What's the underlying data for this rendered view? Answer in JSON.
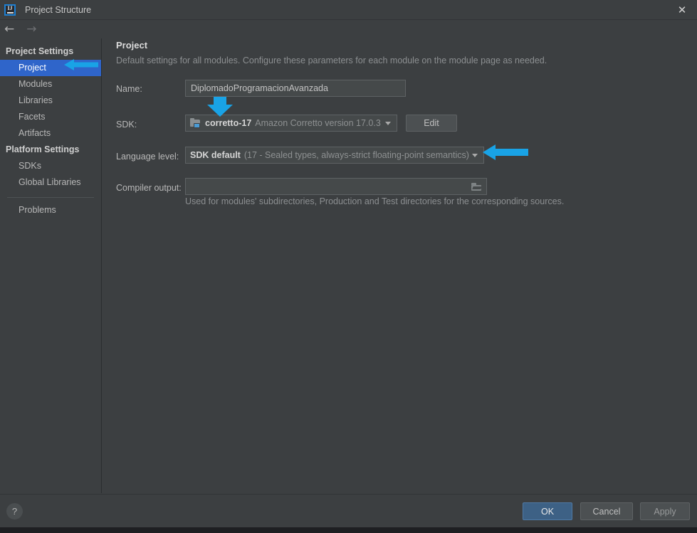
{
  "window": {
    "title": "Project Structure",
    "app_icon": "intellij-idea-icon",
    "close_icon": "close-icon",
    "nav_back_icon": "arrow-left-icon",
    "nav_forward_icon": "arrow-right-icon"
  },
  "sidebar": {
    "groups": [
      {
        "label": "Project Settings",
        "items": [
          {
            "label": "Project",
            "selected": true
          },
          {
            "label": "Modules",
            "selected": false
          },
          {
            "label": "Libraries",
            "selected": false
          },
          {
            "label": "Facets",
            "selected": false
          },
          {
            "label": "Artifacts",
            "selected": false
          }
        ]
      },
      {
        "label": "Platform Settings",
        "items": [
          {
            "label": "SDKs",
            "selected": false
          },
          {
            "label": "Global Libraries",
            "selected": false
          }
        ]
      }
    ],
    "problems": "Problems"
  },
  "main": {
    "title": "Project",
    "description": "Default settings for all modules. Configure these parameters for each module on the module page as needed.",
    "name": {
      "label": "Name:",
      "value": "DiplomadoProgramacionAvanzada",
      "placeholder": ""
    },
    "sdk": {
      "label": "SDK:",
      "icon": "sdk-folder-icon",
      "value_primary": "corretto-17",
      "value_secondary": "Amazon Corretto version 17.0.3",
      "dropdown_icon": "chevron-down-icon",
      "edit_button": "Edit"
    },
    "language_level": {
      "label": "Language level:",
      "value_primary": "SDK default",
      "value_secondary": "(17 - Sealed types, always-strict floating-point semantics)",
      "dropdown_icon": "chevron-down-icon"
    },
    "compiler_output": {
      "label": "Compiler output:",
      "value": "",
      "placeholder": "",
      "browse_icon": "folder-browse-icon",
      "hint": "Used for modules' subdirectories, Production and Test directories for the corresponding sources."
    }
  },
  "footer": {
    "help_icon": "?",
    "ok": "OK",
    "cancel": "Cancel",
    "apply": "Apply"
  },
  "annotations": {
    "color": "#19a3e6",
    "sidebar_project_arrow": "arrow-left-annotation",
    "sdk_arrow": "arrow-down-annotation",
    "language_level_arrow": "arrow-left-annotation"
  },
  "colors": {
    "background": "#3c3f41",
    "selection": "#2f65ca",
    "accent": "#19a3e6",
    "ok_button": "#3d6185"
  }
}
